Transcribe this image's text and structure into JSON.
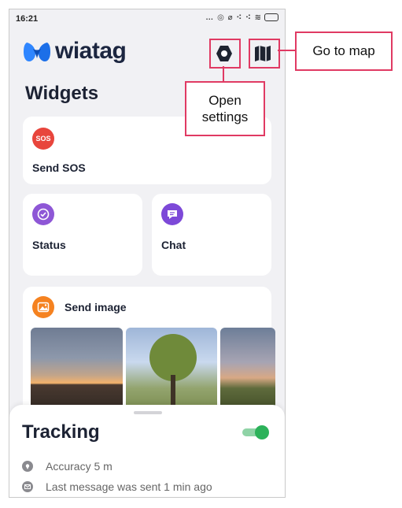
{
  "status_bar": {
    "time": "16:21",
    "icons_text": "… ◎ ⌀ ⁖ ⁖ ≋"
  },
  "app": {
    "brand": "wiatag"
  },
  "header": {
    "title": "Widgets"
  },
  "widgets": {
    "sos": {
      "icon_text": "SOS",
      "label": "Send SOS"
    },
    "status": {
      "label": "Status"
    },
    "chat": {
      "label": "Chat"
    },
    "image": {
      "label": "Send image"
    }
  },
  "tracking": {
    "title": "Tracking",
    "enabled": true,
    "accuracy": "Accuracy 5 m",
    "last_message": "Last message was sent 1 min ago"
  },
  "annotations": {
    "go_to_map": "Go to map",
    "open_settings_line1": "Open",
    "open_settings_line2": "settings"
  },
  "colors": {
    "sos": "#e8453c",
    "status": "#8e57d6",
    "chat": "#7d49d8",
    "image": "#f58220",
    "toggle": "#2cb25a",
    "callout": "#e03a63",
    "logo": "#1c6fe8"
  },
  "icons": [
    "logo-icon",
    "settings-icon",
    "map-icon",
    "check-icon",
    "chat-icon",
    "image-icon",
    "location-pin-icon",
    "mail-icon"
  ]
}
